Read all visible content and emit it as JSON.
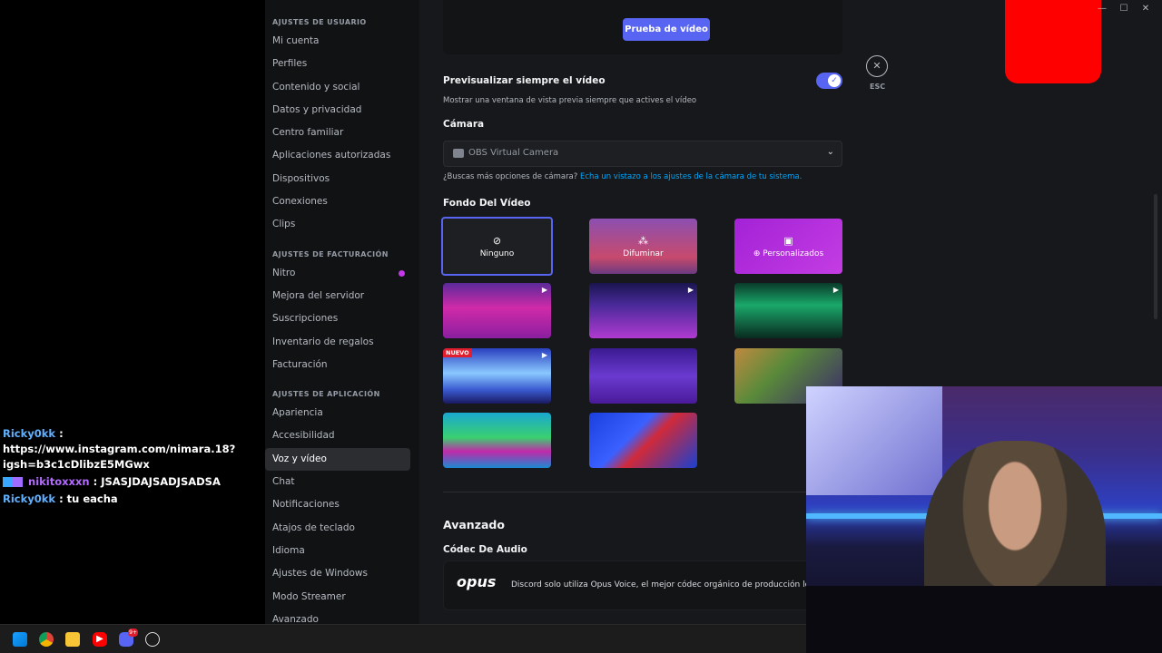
{
  "chat": [
    {
      "user": "Ricky0kk",
      "text": ": https://www.instagram.com/nimara.18?igsh=b3c1cDlibzE5MGwx",
      "badges": false,
      "color": "#5fb0ff"
    },
    {
      "user": "nikitoxxxn",
      "text": ": JSASJDAJSADJSADSA",
      "badges": true,
      "color": "#b36bff"
    },
    {
      "user": "Ricky0kk",
      "text": ": tu eacha",
      "badges": false,
      "color": "#5fb0ff"
    }
  ],
  "sidebar": {
    "user_header": "AJUSTES DE USUARIO",
    "user_items": [
      "Mi cuenta",
      "Perfiles",
      "Contenido y social",
      "Datos y privacidad",
      "Centro familiar",
      "Aplicaciones autorizadas",
      "Dispositivos",
      "Conexiones",
      "Clips"
    ],
    "billing_header": "AJUSTES DE FACTURACIÓN",
    "billing_items": [
      "Nitro",
      "Mejora del servidor",
      "Suscripciones",
      "Inventario de regalos",
      "Facturación"
    ],
    "app_header": "AJUSTES DE APLICACIÓN",
    "app_items": [
      "Apariencia",
      "Accesibilidad",
      "Voz y vídeo",
      "Chat",
      "Notificaciones",
      "Atajos de teclado",
      "Idioma",
      "Ajustes de Windows",
      "Modo Streamer",
      "Avanzado"
    ],
    "active": "Voz y vídeo"
  },
  "video": {
    "test_button": "Prueba de vídeo",
    "always_preview_label": "Previsualizar siempre el vídeo",
    "always_preview_desc": "Mostrar una ventana de vista previa siempre que actives el vídeo",
    "always_preview_on": true,
    "camera_label": "Cámara",
    "camera_value": "OBS Virtual Camera",
    "camera_hint": "¿Buscas más opciones de cámara?",
    "camera_hint_link": "Echa un vistazo a los ajustes de la cámara de tu sistema.",
    "background_label": "Fondo Del Vídeo",
    "bg_none": "Ninguno",
    "bg_blur": "Difuminar",
    "bg_custom": "⊕ Personalizados",
    "new_badge": "NUEVO"
  },
  "advanced": {
    "title": "Avanzado",
    "codec_label": "Códec De Audio",
    "codec_logo": "opus",
    "codec_text": "Discord solo utiliza Opus Voice, el mejor códec orgánico de producción local."
  },
  "esc_label": "ESC",
  "colors": {
    "accent": "#5865f2",
    "link": "#00a8fc",
    "nitro": "#c438e9"
  }
}
